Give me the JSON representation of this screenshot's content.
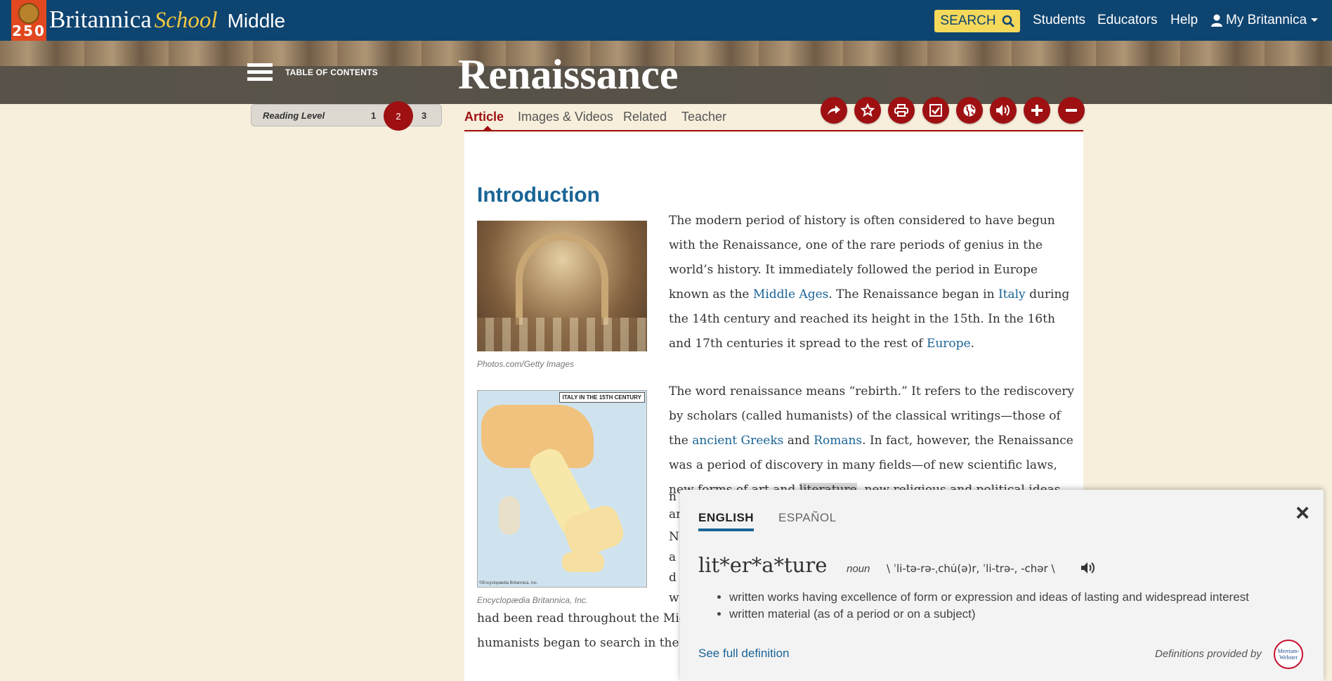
{
  "header": {
    "logo_number": "250",
    "brand_name": "Britannica",
    "brand_school": "School",
    "brand_level": "Middle",
    "search_label": "SEARCH",
    "nav": [
      "Students",
      "Educators",
      "Help",
      "My Britannica"
    ]
  },
  "hero": {
    "toc_label": "TABLE OF CONTENTS",
    "title": "Renaissance"
  },
  "reading_level": {
    "label": "Reading Level",
    "levels": [
      "1",
      "2",
      "3"
    ],
    "active": "2"
  },
  "tabs": [
    "Article",
    "Images & Videos",
    "Related",
    "Teacher"
  ],
  "tools": [
    "share-icon",
    "star-icon",
    "print-icon",
    "check-icon",
    "globe-icon",
    "speaker-icon",
    "plus-icon",
    "minus-icon"
  ],
  "article": {
    "heading": "Introduction",
    "img1_caption": "Photos.com/Getty Images",
    "img2_caption": "Encyclopædia Britannica, Inc.",
    "map_legend": "ITALY IN THE 15TH CENTURY",
    "map_credit": "©Encyclopædia Britannica, Inc.",
    "p1": {
      "t1": "The modern period of history is often considered to have begun with the Renaissance, one of the rare periods of genius in the world’s history. It immediately followed the period in Europe known as the ",
      "l1": "Middle Ages",
      "t2": ". The Renaissance began in ",
      "l2": "Italy",
      "t3": " during the 14th century and reached its height in the 15th. In the 16th and 17th centuries it spread to the rest of ",
      "l3": "Europe",
      "t4": "."
    },
    "p2": {
      "t1": "The word renaissance means “rebirth.” It refers to the rediscovery by scholars (called humanists) of the classical writings—those of the ",
      "l1": "ancient Greeks",
      "t2": " and ",
      "l2": "Romans",
      "t3": ". In fact, however, the Renaissance was a period of discovery in many fields—of new scientific laws, new forms of art and ",
      "hl": "literature",
      "t4": ", new religious and political ideas, and"
    },
    "frag_n": "n",
    "frag_N": "N",
    "frag_a": "a",
    "frag_d": "d",
    "frag_w": "w",
    "line_read": "had been read throughout the Midd",
    "line_search": "humanists began to search in the l"
  },
  "dictionary": {
    "tabs": [
      "ENGLISH",
      "ESPAÑOL"
    ],
    "word": "lit*er*a*ture",
    "pos": "noun",
    "pronunciation": "\\ ˈli-tə-rə-ˌchu̇(ə)r, ˈli-trə-, -chər \\",
    "definitions": [
      "written works having excellence of form or expression and ideas of lasting and widespread interest",
      "written material (as of a period or on a subject)"
    ],
    "see_full": "See full definition",
    "provided_by": "Definitions provided by",
    "mw_logo": "Merriam-Webster"
  }
}
